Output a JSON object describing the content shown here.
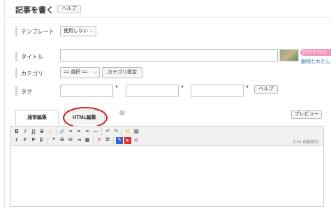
{
  "header": {
    "title": "記事を書く",
    "help_label": "ヘルプ"
  },
  "form": {
    "template": {
      "label": "テンプレート",
      "value": "使用しない"
    },
    "title": {
      "label": "タイトル",
      "value": ""
    },
    "category": {
      "label": "カテゴリ",
      "value": "== 選択 ==",
      "settings_label": "カテゴリ設定"
    },
    "tags": {
      "label": "タグ",
      "help_label": "ヘルプ"
    }
  },
  "promo": {
    "tag_text": "おすすめブログ",
    "link_text": "動物とわたし"
  },
  "tabs": [
    {
      "label": "通常編集",
      "active": true
    },
    {
      "label": "HTML編集",
      "active": false
    }
  ],
  "preview_label": "プレビュー",
  "help_question": "?",
  "editor": {
    "wordcount": "9:46 自動保存",
    "toolbar_row1": [
      {
        "name": "bold-icon",
        "glyph": "B"
      },
      {
        "name": "italic-icon",
        "glyph": "I"
      },
      {
        "name": "underline-icon",
        "glyph": "U"
      },
      {
        "name": "strikethrough-icon",
        "glyph": "S"
      },
      {
        "name": "emoji-icon",
        "glyph": "☺"
      },
      {
        "name": "link-icon",
        "glyph": "🔗"
      },
      {
        "name": "align-left-icon",
        "glyph": "≡"
      },
      {
        "name": "align-center-icon",
        "glyph": "≡"
      },
      {
        "name": "align-right-icon",
        "glyph": "≡"
      },
      {
        "name": "horizontal-rule-icon",
        "glyph": "—"
      },
      {
        "name": "undo-icon",
        "glyph": "↶"
      },
      {
        "name": "redo-icon",
        "glyph": "↷"
      },
      {
        "name": "folder-icon",
        "glyph": "📁"
      },
      {
        "name": "image-icon",
        "glyph": "🖼"
      }
    ],
    "toolbar_row2": [
      {
        "name": "font-size-small-icon",
        "glyph": "F"
      },
      {
        "name": "font-size-medium-icon",
        "glyph": "F"
      },
      {
        "name": "font-size-large-icon",
        "glyph": "F"
      },
      {
        "name": "font-size-xlarge-icon",
        "glyph": "F"
      },
      {
        "name": "quote-icon",
        "glyph": "❝"
      },
      {
        "name": "bullet-list-icon",
        "glyph": "☰"
      },
      {
        "name": "numbered-list-icon",
        "glyph": "☷"
      },
      {
        "name": "indent-icon",
        "glyph": "⇥"
      },
      {
        "name": "table-icon",
        "glyph": "▦"
      },
      {
        "name": "clear-format-icon",
        "glyph": "✕"
      },
      {
        "name": "source-icon",
        "glyph": "⌘"
      },
      {
        "name": "draw-icon",
        "glyph": "✎"
      },
      {
        "name": "youtube-icon",
        "glyph": "▶"
      },
      {
        "name": "instagram-icon",
        "glyph": "◎"
      }
    ]
  },
  "colors": {
    "highlight_circle": "#d11f2c",
    "promo_tag": "#f39bbd",
    "link": "#2b6fb0",
    "youtube": "#e22b2b",
    "instagram": "#c13584",
    "folder": "#e6b422"
  }
}
